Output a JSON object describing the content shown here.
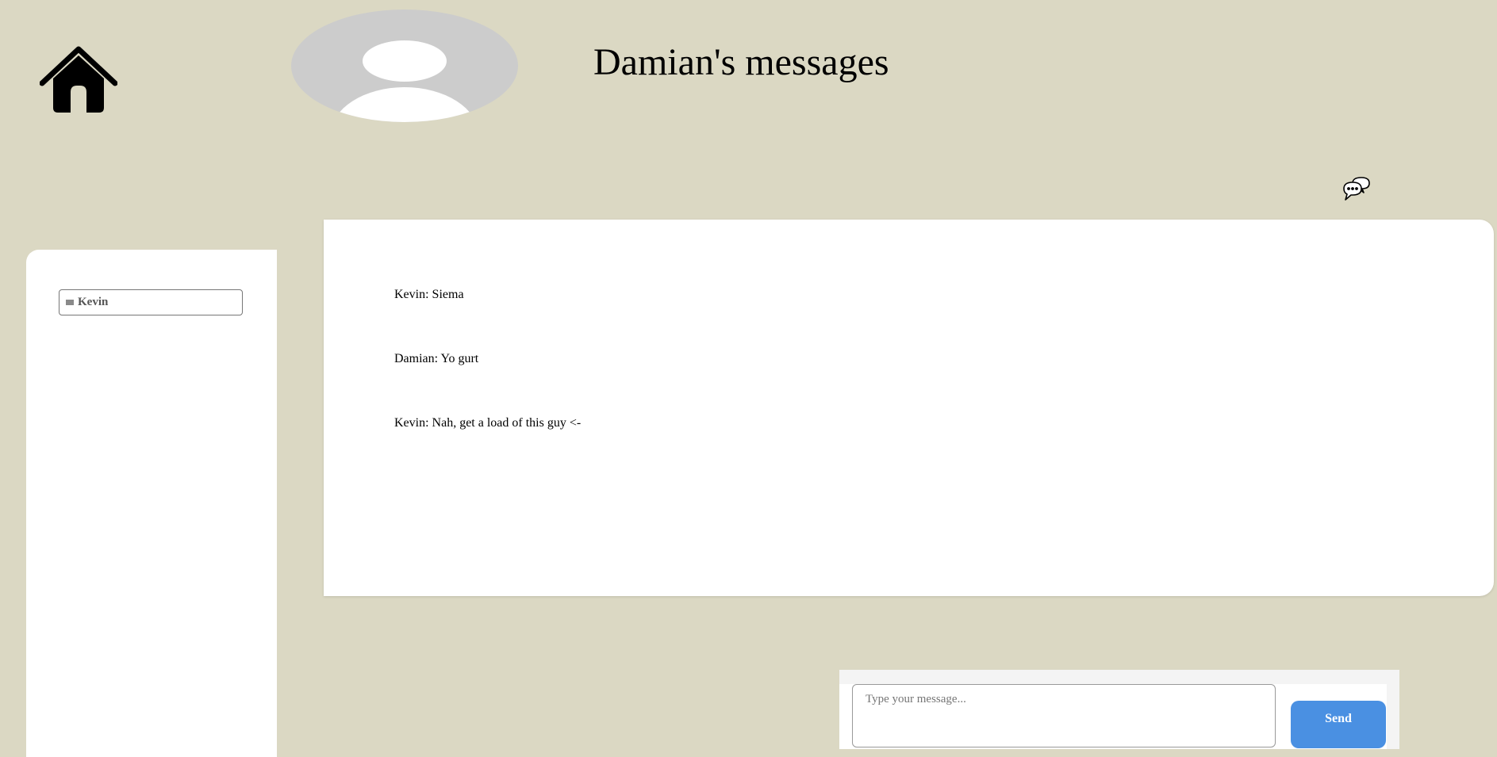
{
  "header": {
    "title": "Damian's messages",
    "home_icon": "home-icon",
    "avatar_icon": "user-avatar-placeholder",
    "chat_icon": "chat-bubbles-icon"
  },
  "sidebar": {
    "contacts": [
      {
        "label": "Kevin",
        "icon": "contact-image-icon"
      }
    ]
  },
  "messages": [
    {
      "text": "Kevin: Siema"
    },
    {
      "text": "Damian: Yo gurt"
    },
    {
      "text": "Kevin: Nah, get a load of this guy <-"
    }
  ],
  "composer": {
    "placeholder": "Type your message...",
    "value": "",
    "send_label": "Send"
  },
  "colors": {
    "background": "#dbd8c3",
    "panel": "#ffffff",
    "avatar": "#cccccc",
    "send_button": "#4a90e2"
  }
}
